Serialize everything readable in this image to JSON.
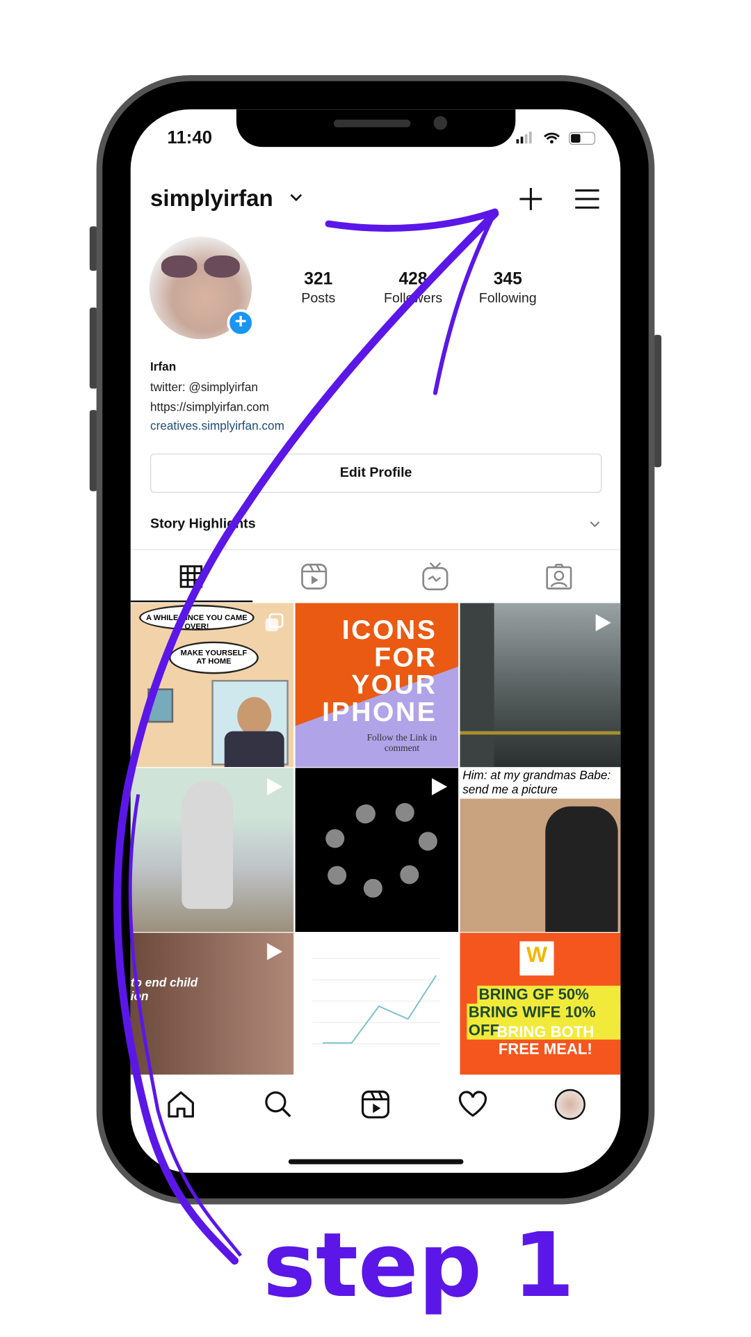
{
  "status": {
    "time": "11:40"
  },
  "header": {
    "username": "simplyirfan"
  },
  "stats": [
    {
      "value": "321",
      "label": "Posts"
    },
    {
      "value": "428",
      "label": "Followers"
    },
    {
      "value": "345",
      "label": "Following"
    }
  ],
  "bio": {
    "name": "Irfan",
    "line1": "twitter: @simplyirfan",
    "line2": "https://simplyirfan.com",
    "link": "creatives.simplyirfan.com"
  },
  "edit_profile": "Edit Profile",
  "story_highlights": "Story Highlights",
  "posts": {
    "p1_a": "A WHILE SINCE YOU CAME OVER!",
    "p1_b": "MAKE YOURSELF AT HOME",
    "p2_title": "ICONS FOR YOUR IPHONE",
    "p2_sub": "Follow the Link in comment",
    "p6_text": "Him: at my grandmas Babe: send me a picture",
    "p7_text": "to end child ion",
    "p9_a": "BRING GF 50% OFF",
    "p9_b": "BRING WIFE 10% OFF",
    "p9_c": "BRING BOTH FREE MEAL!"
  },
  "annotation": {
    "label": "step 1",
    "color": "#5b17e8"
  },
  "colors": {
    "accent_blue": "#1a95f3",
    "link": "#1e4a7a"
  },
  "icons": [
    "new-post-plus",
    "menu",
    "grid",
    "reels",
    "igtv",
    "tagged",
    "home",
    "search",
    "reels",
    "heart",
    "profile"
  ]
}
